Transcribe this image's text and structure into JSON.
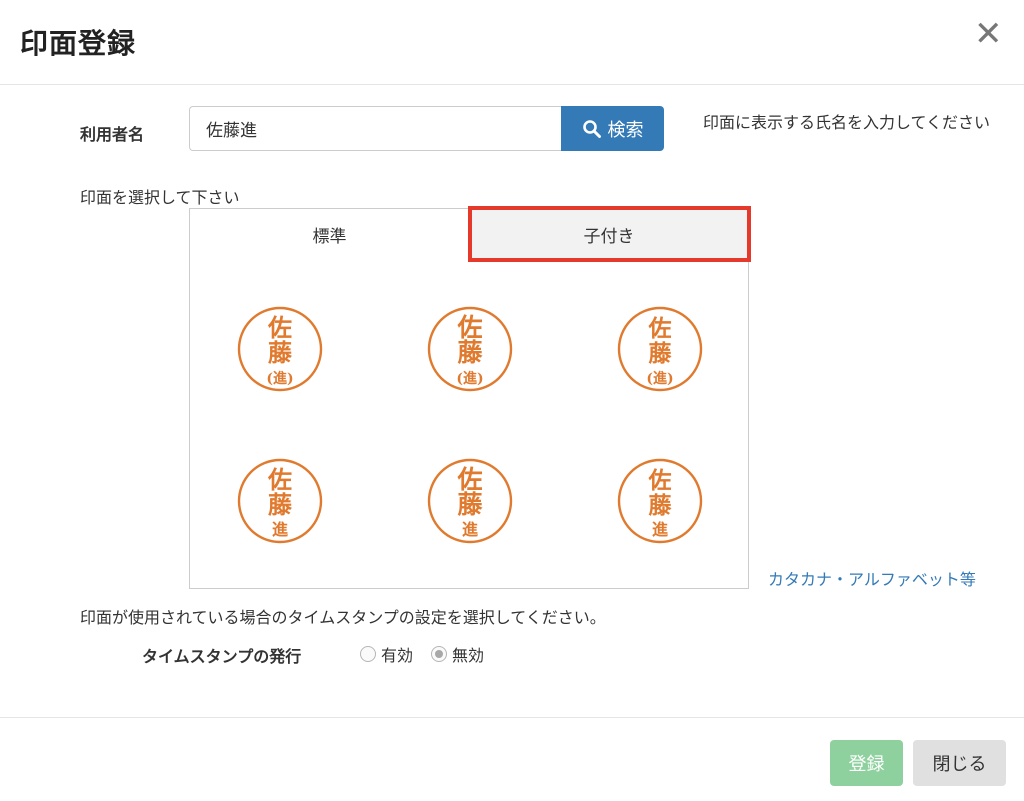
{
  "header": {
    "title": "印面登録",
    "close_symbol": "✕"
  },
  "user": {
    "label": "利用者名",
    "value": "佐藤進",
    "search_label": "検索",
    "hint": "印面に表示する氏名を入力してください"
  },
  "select_label": "印面を選択して下さい",
  "tabs": [
    {
      "label": "標準",
      "active": false
    },
    {
      "label": "子付き",
      "active": true
    }
  ],
  "stamps": {
    "line1": "佐",
    "line2": "藤",
    "child": "進",
    "items": [
      {
        "style": "paren"
      },
      {
        "style": "paren"
      },
      {
        "style": "paren"
      },
      {
        "style": "plain"
      },
      {
        "style": "plain"
      },
      {
        "style": "plain"
      }
    ],
    "color": "#e07a2e"
  },
  "alt_link": "カタカナ・アルファベット等",
  "timestamp": {
    "description": "印面が使用されている場合のタイムスタンプの設定を選択してください。",
    "label": "タイムスタンプの発行",
    "options": [
      {
        "label": "有効",
        "checked": false
      },
      {
        "label": "無効",
        "checked": true
      }
    ]
  },
  "footer": {
    "register_label": "登録",
    "close_label": "閉じる"
  },
  "colors": {
    "primary": "#337ab7",
    "success_disabled": "#8fd19e",
    "highlight": "#e53a2b"
  }
}
